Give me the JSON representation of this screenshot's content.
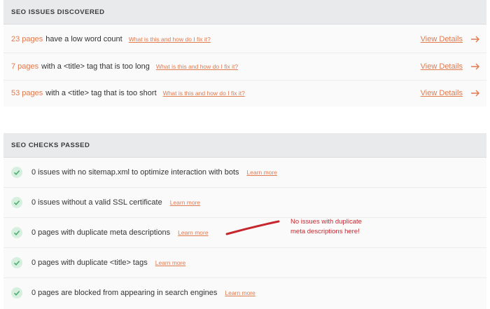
{
  "issues": {
    "header": "SEO ISSUES DISCOVERED",
    "rows": [
      {
        "count": "23 pages",
        "desc": "have a low word count",
        "help": "What is this and how do I fix it?",
        "action": "View Details"
      },
      {
        "count": "7 pages",
        "desc": "with a <title> tag that is too long",
        "help": "What is this and how do I fix it?",
        "action": "View Details"
      },
      {
        "count": "53 pages",
        "desc": "with a <title> tag that is too short",
        "help": "What is this and how do I fix it?",
        "action": "View Details"
      }
    ],
    "arrow_icon": "arrow-right-icon"
  },
  "passed": {
    "header": "SEO CHECKS PASSED",
    "check_icon": "check-circle-icon",
    "rows": [
      {
        "text": "0 issues with no sitemap.xml to optimize interaction with bots",
        "link": "Learn more"
      },
      {
        "text": "0 issues without a valid SSL certificate",
        "link": "Learn more"
      },
      {
        "text": "0 pages with duplicate meta descriptions",
        "link": "Learn more"
      },
      {
        "text": "0 pages with duplicate <title> tags",
        "link": "Learn more"
      },
      {
        "text": "0 pages are blocked from appearing in search engines",
        "link": "Learn more"
      }
    ]
  },
  "annotation": {
    "line1": "No issues with duplicate",
    "line2": "meta descriptions here!"
  },
  "colors": {
    "accent": "#e07a4f",
    "check": "#6cc08b",
    "annotation": "#c6262e",
    "header_bg": "#e9eaec"
  }
}
